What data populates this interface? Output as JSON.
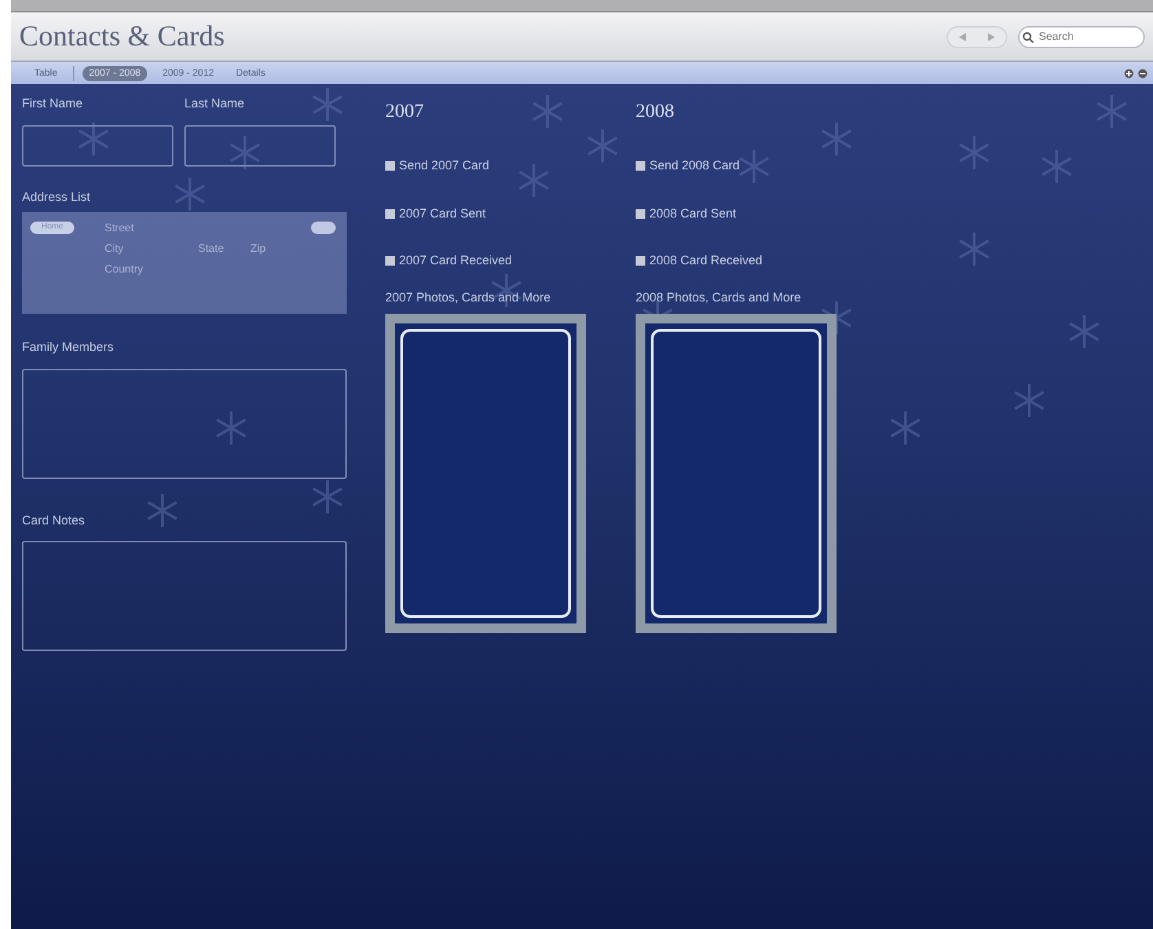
{
  "window": {
    "title": "Contacts & Cards"
  },
  "nav": {
    "search": {
      "placeholder": "Search"
    }
  },
  "tabs": [
    {
      "label": "Table",
      "selected": false
    },
    {
      "label": "2007 - 2008",
      "selected": true
    },
    {
      "label": "2009 - 2012",
      "selected": false
    },
    {
      "label": "Details",
      "selected": false
    }
  ],
  "name_fields": [
    {
      "label": "First Name"
    },
    {
      "label": "Last Name"
    }
  ],
  "address_list": {
    "label": "Address List",
    "type_chip": "Home",
    "fields": [
      "Street",
      "City",
      "State",
      "Zip",
      "Country"
    ]
  },
  "text_areas": [
    {
      "label": "Family Members"
    },
    {
      "label": "Card Notes"
    }
  ],
  "years": [
    {
      "title": "2007",
      "checkboxes": [
        {
          "label": "Send 2007 Card",
          "checked": false
        },
        {
          "label": "2007 Card Sent",
          "checked": false
        },
        {
          "label": "2007 Card Received",
          "checked": false
        }
      ],
      "photos_label": "2007 Photos, Cards and More"
    },
    {
      "title": "2008",
      "checkboxes": [
        {
          "label": "Send 2008 Card",
          "checked": false
        },
        {
          "label": "2008 Card Sent",
          "checked": false
        },
        {
          "label": "2008 Card Received",
          "checked": false
        }
      ],
      "photos_label": "2008 Photos, Cards and More"
    }
  ]
}
